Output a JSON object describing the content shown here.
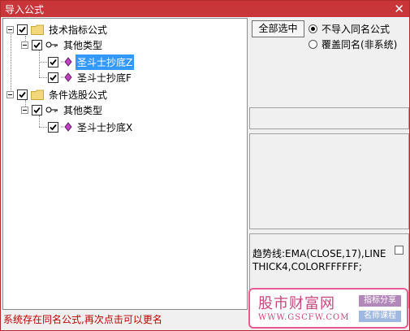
{
  "window": {
    "title": "导入公式",
    "close_glyph": "✕"
  },
  "tree": {
    "root1": {
      "label": "技术指标公式",
      "checked": true
    },
    "group1": {
      "label": "其他类型",
      "checked": true
    },
    "item1": {
      "label": "圣斗士抄底Z",
      "checked": true,
      "selected": true
    },
    "item2": {
      "label": "圣斗士抄底F",
      "checked": true
    },
    "root2": {
      "label": "条件选股公式",
      "checked": true
    },
    "group2": {
      "label": "其他类型",
      "checked": true
    },
    "item3": {
      "label": "圣斗士抄底X",
      "checked": true
    }
  },
  "options": {
    "select_all_label": "全部选中",
    "radio_no_import": "不导入同名公式",
    "radio_overwrite": "覆盖同名(非系统)",
    "selected_radio": "radio_no_import"
  },
  "preview": {
    "formula_text": "趋势线:EMA(CLOSE,17),LINETHICK4,COLORFFFFFF;"
  },
  "status_text": "系统存在同名公式,再次点击可以更名",
  "watermark": {
    "site": "股市财富网",
    "url": "WWW.GSCFW.COM",
    "tag1": "指标分享",
    "tag2": "名师课程"
  },
  "colors": {
    "title_bar": "#c8363a",
    "status_text": "#c00000",
    "selection": "#3399ff",
    "watermark": "#c9467f"
  }
}
